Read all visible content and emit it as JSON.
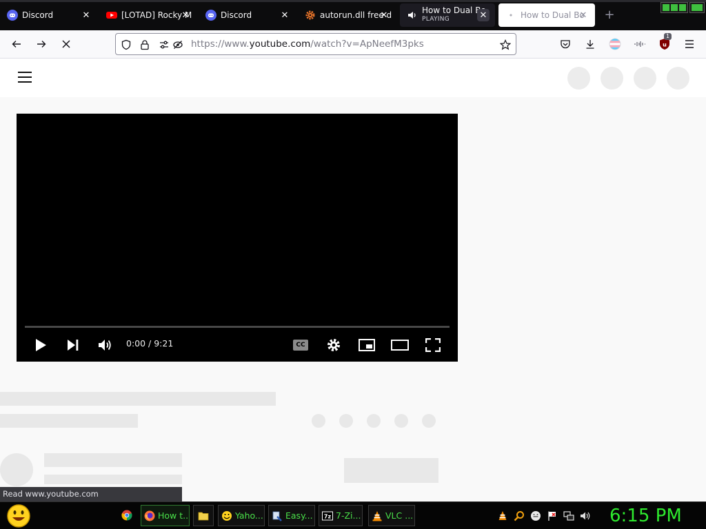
{
  "browser": {
    "tabs": [
      {
        "title": "Discord",
        "icon": "discord-icon"
      },
      {
        "title": "[LOTAD] Rocky M",
        "icon": "youtube-icon"
      },
      {
        "title": "Discord",
        "icon": "discord-icon"
      },
      {
        "title": "autorun.dll free d",
        "icon": "gear-icon"
      },
      {
        "title": "How to Dual Bo",
        "subtitle": "PLAYING",
        "icon": "speaker-icon"
      },
      {
        "title": "How to Dual Bo",
        "icon": "loading-dot-icon"
      }
    ],
    "new_tab_label": "+",
    "url": {
      "prefix": "https://www.",
      "domain": "youtube.com",
      "path": "/watch?v=ApNeefM3pks"
    },
    "extension_badge": "1"
  },
  "video": {
    "time_display": "0:00 / 9:21",
    "cc_label": "CC",
    "progress": 0
  },
  "status_bar": "Read www.youtube.com",
  "taskbar": {
    "items": [
      {
        "label": "How t...",
        "icon": "firefox-icon",
        "active": true
      },
      {
        "label": "",
        "icon": "folder-icon"
      },
      {
        "label": "Yaho...",
        "icon": "smiley-icon"
      },
      {
        "label": "Easy...",
        "icon": "tool-icon"
      },
      {
        "label": "7-Zi...",
        "icon": "7zip-icon"
      },
      {
        "label": "VLC ...",
        "icon": "vlc-icon"
      }
    ],
    "clock": "6:15 PM"
  },
  "colors": {
    "accent_clock": "#2eea2e",
    "taskbar_text": "#4ae04a",
    "youtube_red": "#ff0000"
  }
}
